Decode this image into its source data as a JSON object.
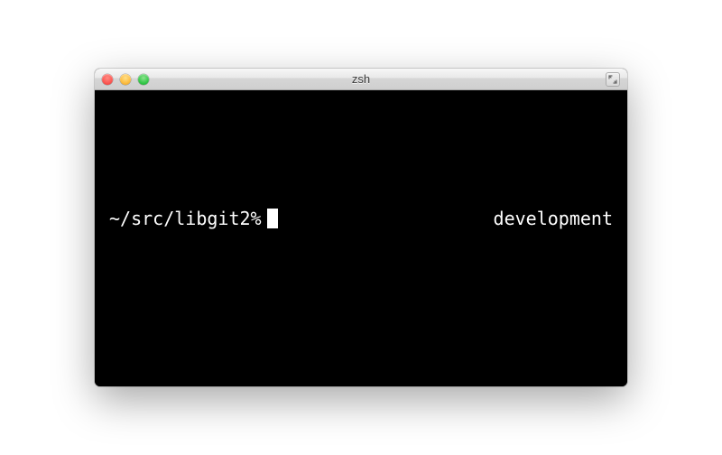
{
  "window": {
    "title": "zsh"
  },
  "terminal": {
    "prompt": "~/src/libgit2%",
    "rprompt": "development"
  }
}
